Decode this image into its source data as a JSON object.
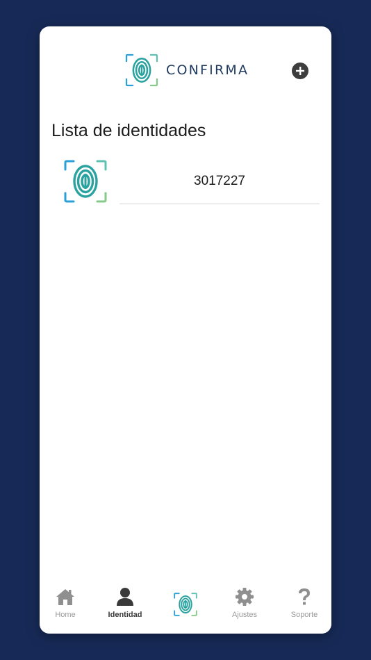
{
  "header": {
    "brand_name": "CONFIRMA",
    "logo_icon": "fingerprint-logo-icon",
    "add_icon": "plus-circle-icon"
  },
  "main": {
    "title": "Lista de identidades",
    "identities": [
      {
        "value": "3017227",
        "icon": "fingerprint-logo-icon"
      }
    ]
  },
  "tabbar": {
    "active_tab": "Identidad",
    "tabs": [
      {
        "label": "Home",
        "icon": "home-icon"
      },
      {
        "label": "Identidad",
        "icon": "user-icon"
      },
      {
        "label": "",
        "icon": "fingerprint-logo-icon"
      },
      {
        "label": "Ajustes",
        "icon": "gear-icon"
      },
      {
        "label": "Soporte",
        "icon": "question-icon"
      }
    ]
  },
  "colors": {
    "background": "#172a57",
    "card": "#ffffff",
    "brand_text": "#1f3a5f",
    "logo_teal": "#2aa3a0",
    "logo_blue": "#2b9fd6",
    "logo_green": "#86c98a",
    "tab_inactive": "#9a9a9a",
    "tab_active": "#3a3a3a"
  }
}
